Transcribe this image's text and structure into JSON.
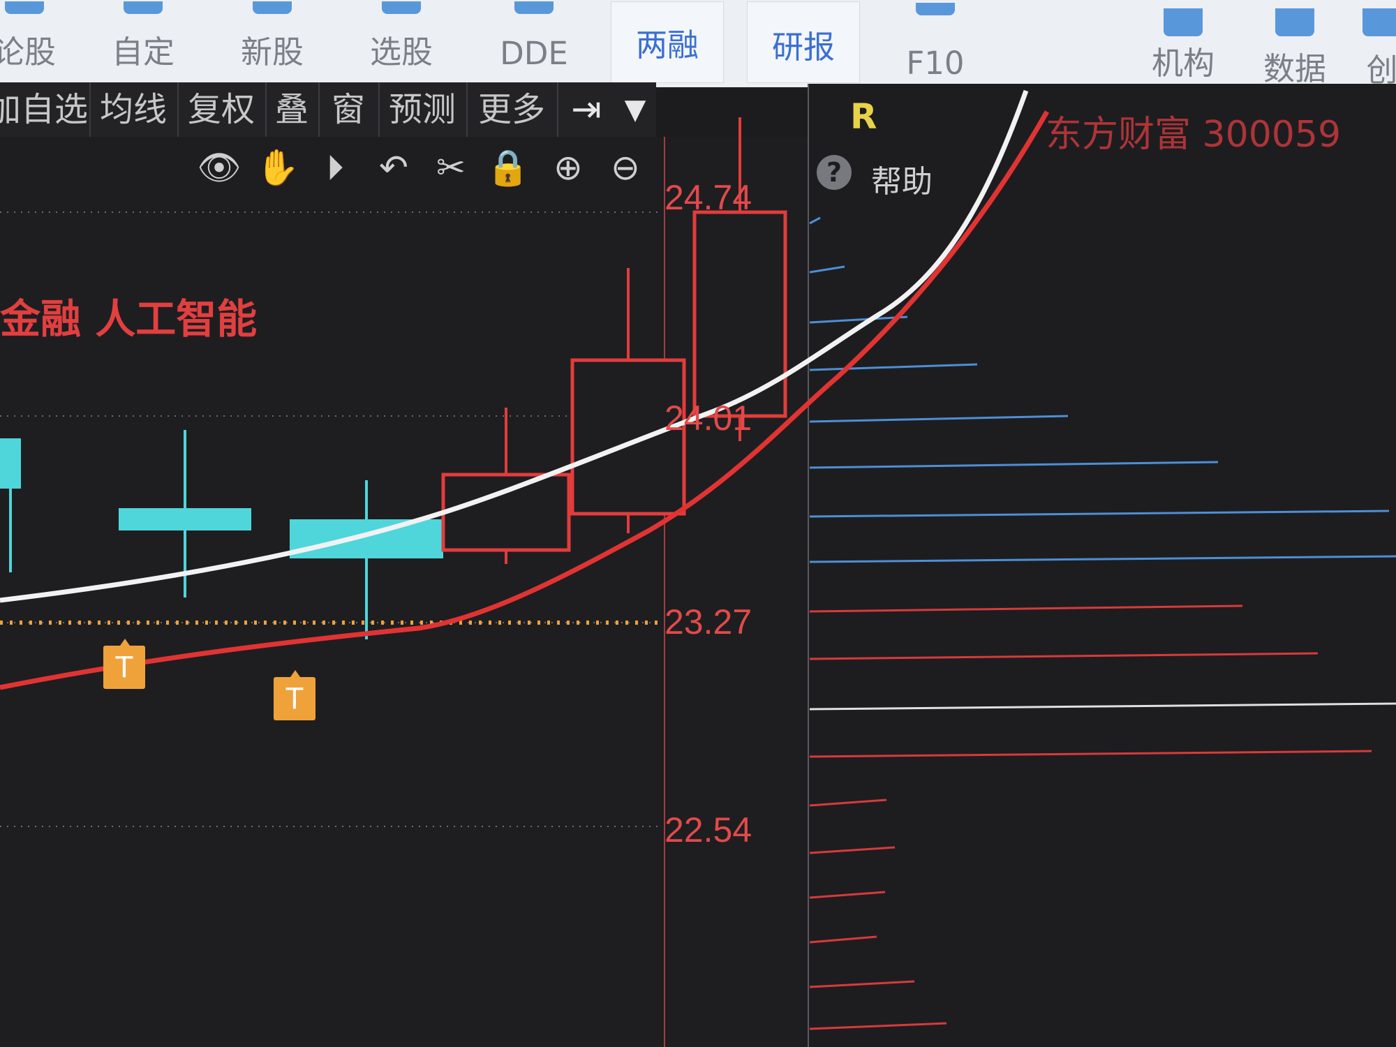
{
  "toolbar": {
    "items": [
      {
        "label": "论股",
        "name": "tab-lungu"
      },
      {
        "label": "自定",
        "name": "tab-custom"
      },
      {
        "label": "新股",
        "name": "tab-new-stock"
      },
      {
        "label": "选股",
        "name": "tab-stock-picker"
      },
      {
        "label": "DDE",
        "name": "tab-dde"
      },
      {
        "label": "两融",
        "name": "tab-margin"
      },
      {
        "label": "研报",
        "name": "tab-research"
      },
      {
        "label": "F10",
        "name": "tab-f10"
      },
      {
        "label": "机构",
        "name": "tab-institution"
      },
      {
        "label": "数据",
        "name": "tab-data"
      },
      {
        "label": "创",
        "name": "tab-chuang"
      }
    ]
  },
  "subtoolbar": {
    "items": [
      "加自选",
      "均线",
      "复权",
      "叠",
      "窗",
      "预测",
      "更多"
    ]
  },
  "chart": {
    "concept_text": "金融 人工智能",
    "price_labels": [
      "24.74",
      "24.01",
      "23.27",
      "22.54"
    ],
    "t_marker_label": "T"
  },
  "right_panel": {
    "r_label": "R",
    "stock_name": "东方财富 300059",
    "help_label": "帮助",
    "help_icon": "?"
  },
  "chart_data": {
    "type": "candlestick",
    "price_ticks": [
      24.74,
      24.01,
      23.27,
      22.54
    ],
    "candles": [
      {
        "open": 23.75,
        "close": 23.93,
        "high": 23.93,
        "low": 23.45,
        "color": "cyan"
      },
      {
        "open": 23.68,
        "close": 23.6,
        "high": 23.96,
        "low": 23.36,
        "color": "cyan"
      },
      {
        "open": 23.64,
        "close": 23.5,
        "high": 23.78,
        "low": 23.21,
        "color": "cyan"
      },
      {
        "open": 23.53,
        "close": 23.8,
        "high": 24.04,
        "low": 23.48,
        "color": "red"
      },
      {
        "open": 23.66,
        "close": 24.21,
        "high": 24.54,
        "low": 23.59,
        "color": "red"
      },
      {
        "open": 24.01,
        "close": 24.74,
        "high": 25.08,
        "low": 23.92,
        "color": "red"
      }
    ],
    "reference_line": 23.27,
    "colors": {
      "up": "#e23c3c",
      "down": "#4fd6db",
      "ma_white": "#f2f2f2",
      "ma_red": "#e23333"
    },
    "volume_profile_colors": {
      "upper": "#4d8fd6",
      "lower": "#d83a3a",
      "mid": "#e0e0e0"
    }
  }
}
